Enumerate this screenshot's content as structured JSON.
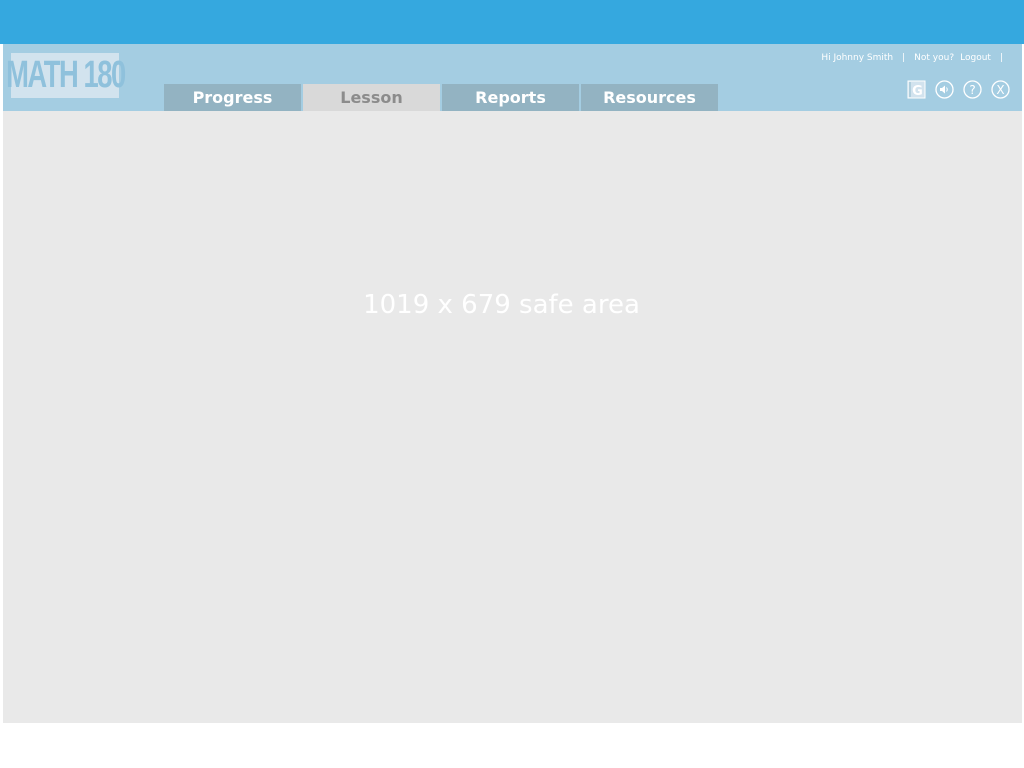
{
  "app": {
    "logo_text": "MATH 180"
  },
  "user_bar": {
    "greeting": "Hi Johnny Smith",
    "separator": "|",
    "not_you": "Not you?",
    "logout": "Logout",
    "trailing_separator": "|"
  },
  "tabs": [
    {
      "label": "Progress",
      "active": false
    },
    {
      "label": "Lesson",
      "active": true
    },
    {
      "label": "Reports",
      "active": false
    },
    {
      "label": "Resources",
      "active": false
    }
  ],
  "icons": [
    {
      "name": "glossary-icon",
      "glyph": "G"
    },
    {
      "name": "audio-icon",
      "glyph": "speaker"
    },
    {
      "name": "help-icon",
      "glyph": "?"
    },
    {
      "name": "close-icon",
      "glyph": "X"
    }
  ],
  "main": {
    "safe_area_label": "1019 x 679 safe area"
  },
  "colors": {
    "top_bar": "#35a8df",
    "header": "#a4cde2",
    "tab_inactive": "#93b3c2",
    "tab_active": "#d9d9d9",
    "content_background": "#e9e9e9"
  }
}
